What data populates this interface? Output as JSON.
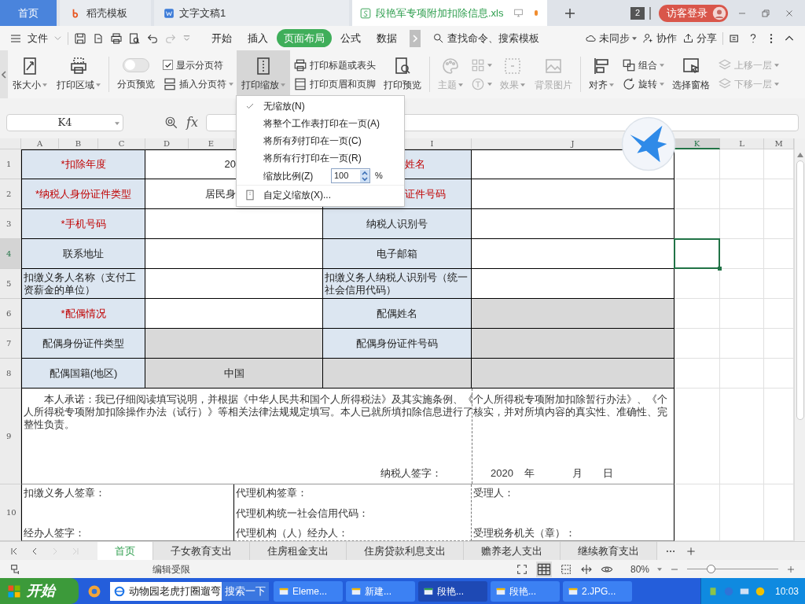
{
  "app_tabs": [
    {
      "kind": "home",
      "label": "首页",
      "selected": false
    },
    {
      "kind": "docer",
      "label": "稻壳模板",
      "selected": false
    },
    {
      "kind": "writer",
      "label": "文字文稿1",
      "selected": false
    },
    {
      "kind": "sheet",
      "label": "段艳军专项附加扣除信息.xls",
      "selected": true,
      "unsaved": true
    }
  ],
  "window_count": "2",
  "login": "访客登录",
  "menu_bar": {
    "file": "文件",
    "tabs": [
      {
        "label": "开始",
        "selected": false
      },
      {
        "label": "插入",
        "selected": false
      },
      {
        "label": "页面布局",
        "selected": true
      },
      {
        "label": "公式",
        "selected": false
      },
      {
        "label": "数据",
        "selected": false
      }
    ],
    "search": "查找命令、搜索模板",
    "actions": [
      "未同步",
      "协作",
      "分享"
    ]
  },
  "ribbon": [
    {
      "kind": "large",
      "label": "张大小",
      "caret": true,
      "disabled": false,
      "pressed": false
    },
    {
      "kind": "large",
      "label": "打印区域",
      "caret": true,
      "disabled": false,
      "pressed": false
    },
    {
      "kind": "separator"
    },
    {
      "kind": "toggle",
      "label": "分页预览",
      "on": false
    },
    {
      "kind": "stack",
      "items": [
        {
          "kind": "check",
          "label": "显示分页符",
          "checked": true
        },
        {
          "kind": "button",
          "label": "插入分页符",
          "caret": true,
          "disabled": false
        }
      ]
    },
    {
      "kind": "large",
      "label": "打印缩放",
      "caret": true,
      "disabled": false,
      "pressed": true
    },
    {
      "kind": "stack",
      "items": [
        {
          "kind": "button",
          "label": "打印标题或表头",
          "caret": false,
          "disabled": false
        },
        {
          "kind": "button",
          "label": "打印页眉和页脚",
          "caret": false,
          "disabled": false
        }
      ]
    },
    {
      "kind": "large",
      "label": "打印预览",
      "caret": false,
      "disabled": false,
      "pressed": false
    },
    {
      "kind": "separator"
    },
    {
      "kind": "large",
      "label": "主题",
      "caret": true,
      "disabled": true,
      "pressed": false
    },
    {
      "kind": "stack",
      "items": [
        {
          "kind": "button",
          "caret": true,
          "disabled": true
        },
        {
          "kind": "button",
          "caret": true,
          "disabled": true
        }
      ]
    },
    {
      "kind": "large",
      "label": "效果",
      "caret": true,
      "disabled": true,
      "pressed": false
    },
    {
      "kind": "large",
      "label": "背景图片",
      "caret": false,
      "disabled": true,
      "pressed": false
    },
    {
      "kind": "separator"
    },
    {
      "kind": "large",
      "label": "对齐",
      "caret": true,
      "disabled": false,
      "pressed": false
    },
    {
      "kind": "stack",
      "items": [
        {
          "kind": "button",
          "label": "组合",
          "caret": true,
          "disabled": false
        },
        {
          "kind": "button",
          "label": "旋转",
          "caret": true,
          "disabled": false
        }
      ]
    },
    {
      "kind": "large",
      "label": "选择窗格",
      "caret": false,
      "disabled": false,
      "pressed": false
    },
    {
      "kind": "stack",
      "items": [
        {
          "kind": "button",
          "label": "上移一层",
          "caret": true,
          "disabled": true
        },
        {
          "kind": "button",
          "label": "下移一层",
          "caret": true,
          "disabled": true
        }
      ]
    }
  ],
  "formula_bar": {
    "cell": "K4",
    "fx": "fx"
  },
  "columns": [
    {
      "label": "A",
      "selected": false
    },
    {
      "label": "B",
      "selected": false
    },
    {
      "label": "C",
      "selected": false
    },
    {
      "label": "D",
      "selected": false
    },
    {
      "label": "E",
      "selected": false
    },
    {
      "label": "I",
      "selected": false
    },
    {
      "label": "J",
      "selected": false
    },
    {
      "label": "K",
      "selected": true
    },
    {
      "label": "L",
      "selected": false
    },
    {
      "label": "M",
      "selected": false
    }
  ],
  "rows": [
    {
      "number": "1",
      "kind": "form",
      "selected": false,
      "cells": [
        {
          "kind": "label",
          "text": "*扣除年度",
          "required": true
        },
        {
          "kind": "value",
          "text": "20",
          "shaded": false
        },
        {
          "kind": "label",
          "text": "姓名",
          "required": true
        },
        {
          "kind": "value",
          "shaded": false
        }
      ]
    },
    {
      "number": "2",
      "kind": "form",
      "selected": false,
      "cells": [
        {
          "kind": "label",
          "text": "*纳税人身份证件类型",
          "required": true
        },
        {
          "kind": "value",
          "text": "居民身",
          "shaded": false
        },
        {
          "kind": "label",
          "text": "证件号码",
          "required": true
        },
        {
          "kind": "value",
          "shaded": false
        }
      ]
    },
    {
      "number": "3",
      "kind": "form",
      "selected": false,
      "cells": [
        {
          "kind": "label",
          "text": "*手机号码",
          "required": true
        },
        {
          "kind": "value",
          "shaded": false
        },
        {
          "kind": "label",
          "text": "纳税人识别号",
          "required": false
        },
        {
          "kind": "value",
          "shaded": false
        }
      ]
    },
    {
      "number": "4",
      "kind": "form",
      "selected": true,
      "cells": [
        {
          "kind": "label",
          "text": "联系地址",
          "required": false
        },
        {
          "kind": "value",
          "shaded": false
        },
        {
          "kind": "label",
          "text": "电子邮箱",
          "required": false
        },
        {
          "kind": "value",
          "shaded": false
        }
      ]
    },
    {
      "number": "5",
      "kind": "form",
      "selected": false,
      "cells": [
        {
          "kind": "label",
          "text": "扣缴义务人名称（支付工资薪金的单位）",
          "required": false
        },
        {
          "kind": "value",
          "shaded": false
        },
        {
          "kind": "label",
          "text": "扣缴义务人纳税人识别号（统一社会信用代码）",
          "required": false
        },
        {
          "kind": "value",
          "shaded": false
        }
      ]
    },
    {
      "number": "6",
      "kind": "form",
      "selected": false,
      "cells": [
        {
          "kind": "label",
          "text": "*配偶情况",
          "required": true
        },
        {
          "kind": "value",
          "shaded": false
        },
        {
          "kind": "label",
          "text": "配偶姓名",
          "required": false
        },
        {
          "kind": "value",
          "shaded": true
        }
      ]
    },
    {
      "number": "7",
      "kind": "form",
      "selected": false,
      "cells": [
        {
          "kind": "label",
          "text": "配偶身份证件类型",
          "required": false
        },
        {
          "kind": "value",
          "shaded": true
        },
        {
          "kind": "label",
          "text": "配偶身份证件号码",
          "required": false
        },
        {
          "kind": "value",
          "shaded": true
        }
      ]
    },
    {
      "number": "8",
      "kind": "form",
      "selected": false,
      "cells": [
        {
          "kind": "label",
          "text": "配偶国籍(地区)",
          "required": false
        },
        {
          "kind": "value",
          "text": "中国",
          "shaded": true
        },
        {
          "kind": "value",
          "shaded": true
        },
        {
          "kind": "value",
          "shaded": true
        }
      ]
    },
    {
      "number": "9",
      "kind": "statement",
      "selected": false,
      "text": "本人承诺：我已仔细阅读填写说明，并根据《中华人民共和国个人所得税法》及其实施条例、《个人所得税专项附加扣除暂行办法》、《个人所得税专项附加扣除操作办法（试行）》等相关法律法规规定填写。本人已就所填扣除信息进行了核实，并对所填内容的真实性、准确性、完整性负责。",
      "signature": "纳税人签字：",
      "date": [
        "2020",
        "年",
        "月",
        "日"
      ]
    },
    {
      "number": "10",
      "kind": "signature",
      "selected": false,
      "cells": [
        {
          "lines": [
            "扣缴义务人签章：",
            "经办人签字："
          ]
        },
        {
          "lines": [
            "代理机构签章：",
            "代理机构统一社会信用代码：",
            "代理机构（人）经办人："
          ]
        },
        {
          "lines": [
            "受理人：",
            "受理税务机关（章）："
          ]
        }
      ]
    }
  ],
  "print_scale_menu": [
    {
      "kind": "option",
      "label": "无缩放(N)",
      "checked": true
    },
    {
      "kind": "option",
      "label": "将整个工作表打印在一页(A)",
      "checked": false
    },
    {
      "kind": "option",
      "label": "将所有列打印在一页(C)",
      "checked": false
    },
    {
      "kind": "option",
      "label": "将所有行打印在一页(R)",
      "checked": false
    },
    {
      "kind": "scale",
      "label": "缩放比例(Z)",
      "value": "100",
      "unit": "%"
    },
    {
      "kind": "custom",
      "label": "自定义缩放(X)..."
    }
  ],
  "sheets": [
    {
      "label": "首页",
      "selected": true
    },
    {
      "label": "子女教育支出",
      "selected": false
    },
    {
      "label": "住房租金支出",
      "selected": false
    },
    {
      "label": "住房贷款利息支出",
      "selected": false
    },
    {
      "label": "赡养老人支出",
      "selected": false
    },
    {
      "label": "继续教育支出",
      "selected": false
    }
  ],
  "status_bar": {
    "mode": "编辑受限",
    "zoom": "80%",
    "level": 0.26
  },
  "taskbar": {
    "start": "开始",
    "search_value": "动物园老虎打圈遛弯",
    "search_button": "搜索一下",
    "tasks": [
      {
        "label": "Eleme...",
        "selected": false
      },
      {
        "label": "新建...",
        "selected": false
      },
      {
        "label": "段艳...",
        "selected": true
      },
      {
        "label": "段艳...",
        "selected": false
      },
      {
        "label": "2.JPG...",
        "selected": false
      }
    ],
    "clock": "10:03"
  }
}
